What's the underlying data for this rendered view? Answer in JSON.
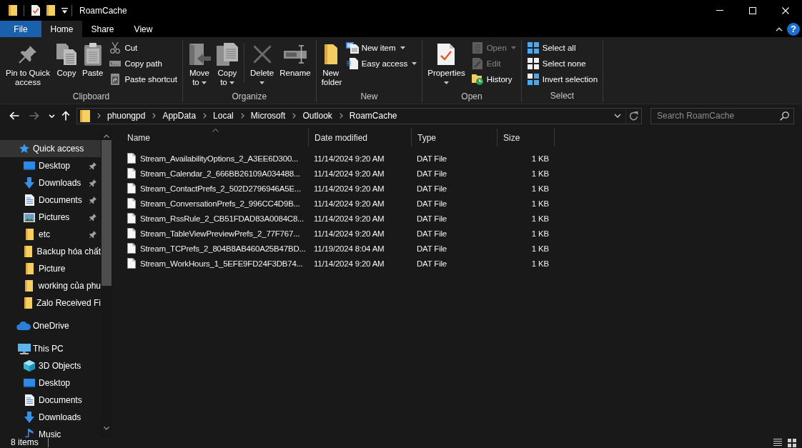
{
  "window": {
    "title": "RoamCache"
  },
  "ribbon_tabs": [
    {
      "kind": "file",
      "label": "File",
      "selected": false
    },
    {
      "kind": "tab",
      "label": "Home",
      "selected": true
    },
    {
      "kind": "tab",
      "label": "Share",
      "selected": false
    },
    {
      "kind": "tab",
      "label": "View",
      "selected": false
    }
  ],
  "help_button": {
    "label": "?"
  },
  "ribbon_groups": [
    {
      "label": "Clipboard",
      "items": [
        {
          "kind": "large",
          "label": "Pin to Quick access",
          "dropdown": false,
          "disabled": false
        },
        {
          "kind": "large",
          "label": "Copy",
          "dropdown": false,
          "disabled": false
        },
        {
          "kind": "large",
          "label": "Paste",
          "dropdown": false,
          "disabled": false
        },
        {
          "kind": "small",
          "label": "Cut",
          "dropdown": false,
          "disabled": false
        },
        {
          "kind": "small",
          "label": "Copy path",
          "dropdown": false,
          "disabled": false
        },
        {
          "kind": "small",
          "label": "Paste shortcut",
          "dropdown": false,
          "disabled": false
        }
      ]
    },
    {
      "label": "Organize",
      "items": [
        {
          "kind": "large",
          "label": "Move to",
          "dropdown": true,
          "disabled": false
        },
        {
          "kind": "large",
          "label": "Copy to",
          "dropdown": true,
          "disabled": false
        },
        {
          "kind": "divider"
        },
        {
          "kind": "large",
          "label": "Delete",
          "dropdown": true,
          "disabled": false
        },
        {
          "kind": "large",
          "label": "Rename",
          "dropdown": false,
          "disabled": false
        }
      ]
    },
    {
      "label": "New",
      "items": [
        {
          "kind": "large",
          "label": "New folder",
          "dropdown": false,
          "disabled": false
        },
        {
          "kind": "small",
          "label": "New item",
          "dropdown": true,
          "disabled": false
        },
        {
          "kind": "small",
          "label": "Easy access",
          "dropdown": true,
          "disabled": false
        }
      ]
    },
    {
      "label": "Open",
      "items": [
        {
          "kind": "large",
          "label": "Properties",
          "dropdown": true,
          "disabled": false
        },
        {
          "kind": "small",
          "label": "Open",
          "dropdown": true,
          "disabled": true
        },
        {
          "kind": "small",
          "label": "Edit",
          "dropdown": false,
          "disabled": true
        },
        {
          "kind": "small",
          "label": "History",
          "dropdown": false,
          "disabled": false
        }
      ]
    },
    {
      "label": "Select",
      "items": [
        {
          "kind": "small",
          "label": "Select all",
          "dropdown": false,
          "disabled": false
        },
        {
          "kind": "small",
          "label": "Select none",
          "dropdown": false,
          "disabled": false
        },
        {
          "kind": "small",
          "label": "Invert selection",
          "dropdown": false,
          "disabled": false
        }
      ]
    }
  ],
  "navigation_buttons": [
    {
      "kind": "back",
      "disabled": false
    },
    {
      "kind": "forward",
      "disabled": true
    },
    {
      "kind": "recent",
      "disabled": false
    },
    {
      "kind": "up",
      "disabled": false
    }
  ],
  "address_bar": {
    "breadcrumbs": [
      "phuongpd",
      "AppData",
      "Local",
      "Microsoft",
      "Outlook",
      "RoamCache"
    ]
  },
  "search": {
    "placeholder": "Search RoamCache"
  },
  "navigation_pane": {
    "items": [
      {
        "kind": "quick_access",
        "label": "Quick access",
        "selected": true,
        "children": [
          {
            "kind": "desktop",
            "label": "Desktop",
            "pinned": true,
            "selected": false
          },
          {
            "kind": "downloads",
            "label": "Downloads",
            "pinned": true,
            "selected": false
          },
          {
            "kind": "documents",
            "label": "Documents",
            "pinned": true,
            "selected": false
          },
          {
            "kind": "pictures",
            "label": "Pictures",
            "pinned": true,
            "selected": false
          },
          {
            "kind": "folder",
            "label": "etc",
            "pinned": true,
            "selected": false
          },
          {
            "kind": "folder",
            "label": "Backup hóa chất",
            "pinned": false,
            "selected": false
          },
          {
            "kind": "folder",
            "label": "Picture",
            "pinned": false,
            "selected": false
          },
          {
            "kind": "folder",
            "label": "working của phu",
            "pinned": false,
            "selected": false
          },
          {
            "kind": "folder",
            "label": "Zalo Received Fi",
            "pinned": false,
            "selected": false
          }
        ]
      },
      {
        "kind": "cloud",
        "label": "OneDrive",
        "selected": false
      },
      {
        "kind": "computer",
        "label": "This PC",
        "selected": false,
        "children": [
          {
            "kind": "cube",
            "label": "3D Objects",
            "selected": false
          },
          {
            "kind": "desktop",
            "label": "Desktop",
            "selected": false
          },
          {
            "kind": "documents",
            "label": "Documents",
            "selected": false
          },
          {
            "kind": "downloads",
            "label": "Downloads",
            "selected": false
          },
          {
            "kind": "music",
            "label": "Music",
            "selected": false
          }
        ]
      }
    ]
  },
  "file_list": {
    "columns": [
      {
        "label": "Name",
        "sorted": true
      },
      {
        "label": "Date modified",
        "sorted": false
      },
      {
        "label": "Type",
        "sorted": false
      },
      {
        "label": "Size",
        "sorted": false
      }
    ],
    "rows": [
      {
        "name": "Stream_AvailabilityOptions_2_A3EE6D300...",
        "date_modified": "11/14/2024 9:20 AM",
        "type": "DAT File",
        "size": "1 KB",
        "selected": false
      },
      {
        "name": "Stream_Calendar_2_666BB26109A034488...",
        "date_modified": "11/14/2024 9:20 AM",
        "type": "DAT File",
        "size": "1 KB",
        "selected": false
      },
      {
        "name": "Stream_ContactPrefs_2_502D2796946A5E...",
        "date_modified": "11/14/2024 9:20 AM",
        "type": "DAT File",
        "size": "1 KB",
        "selected": false
      },
      {
        "name": "Stream_ConversationPrefs_2_996CC4D9B...",
        "date_modified": "11/14/2024 9:20 AM",
        "type": "DAT File",
        "size": "1 KB",
        "selected": false
      },
      {
        "name": "Stream_RssRule_2_CB51FDAD83A0084C8...",
        "date_modified": "11/14/2024 9:20 AM",
        "type": "DAT File",
        "size": "1 KB",
        "selected": false
      },
      {
        "name": "Stream_TableViewPreviewPrefs_2_77F767...",
        "date_modified": "11/14/2024 9:20 AM",
        "type": "DAT File",
        "size": "1 KB",
        "selected": false
      },
      {
        "name": "Stream_TCPrefs_2_804B8AB460A25B47BD...",
        "date_modified": "11/19/2024 8:04 AM",
        "type": "DAT File",
        "size": "1 KB",
        "selected": false
      },
      {
        "name": "Stream_WorkHours_1_5EFE9FD24F3DB74...",
        "date_modified": "11/14/2024 9:20 AM",
        "type": "DAT File",
        "size": "1 KB",
        "selected": false
      }
    ]
  },
  "status_bar": {
    "item_count": "8 items"
  }
}
